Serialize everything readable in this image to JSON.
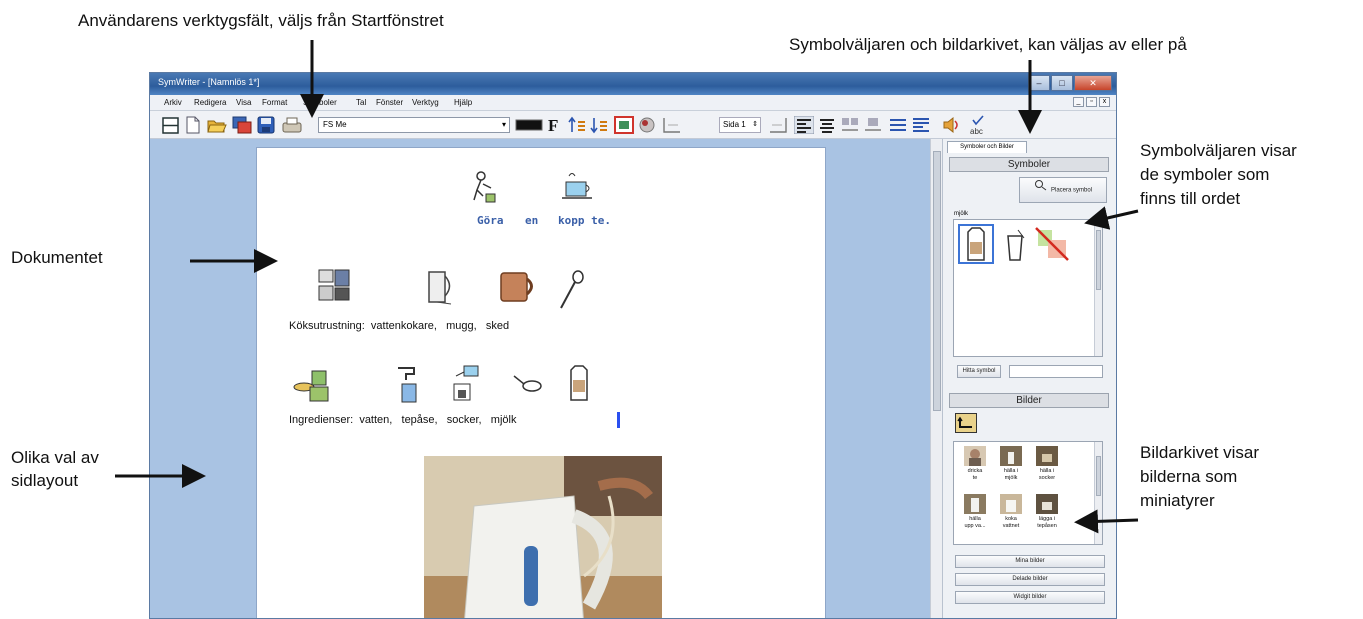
{
  "callouts": {
    "toolbar": "Användarens verktygsfält, väljs från Startfönstret",
    "symbol_chooser": "Symbolväljaren och bildarkivet, kan väljas av eller på",
    "document": "Dokumentet",
    "layout_line1": "Olika val av",
    "layout_line2": "sidlayout",
    "symbols_line1": "Symbolväljaren visar",
    "symbols_line2": "de  symboler som",
    "symbols_line3": "finns till ordet",
    "archive_line1": "Bildarkivet visar",
    "archive_line2": "bilderna som",
    "archive_line3": "miniatyrer"
  },
  "window": {
    "title": "SymWriter - [Namnlös 1*]",
    "menu": [
      "Arkiv",
      "Redigera",
      "Visa",
      "Format",
      "Symboler",
      "Tal",
      "Fönster",
      "Verktyg",
      "Hjälp"
    ]
  },
  "toolbar": {
    "font": "FS Me",
    "page": "Sida 1"
  },
  "document": {
    "line1": [
      "Göra",
      "en",
      "kopp te."
    ],
    "line2": "Köksutrustning:  vattenkokare,   mugg,   sked",
    "line3": "Ingredienser:  vatten,   tepåse,   socker,   mjölk"
  },
  "panel": {
    "tab": "Symboler och Bilder",
    "symbols_header": "Symboler",
    "place_symbol": "Placera symbol",
    "word_label": "mjölk",
    "hide_symbol": "Hitta symbol",
    "images_header": "Bilder",
    "thumbs": [
      {
        "l1": "dricka",
        "l2": "te"
      },
      {
        "l1": "hälla i",
        "l2": "mjölk"
      },
      {
        "l1": "hälla i",
        "l2": "socker"
      },
      {
        "l1": "hälla",
        "l2": "upp va..."
      },
      {
        "l1": "koka",
        "l2": "vattnet"
      },
      {
        "l1": "lägga i",
        "l2": "tepåsen"
      }
    ],
    "btn_my": "Mina bilder",
    "btn_shared": "Delade bilder",
    "btn_widgit": "Widgit bilder"
  }
}
